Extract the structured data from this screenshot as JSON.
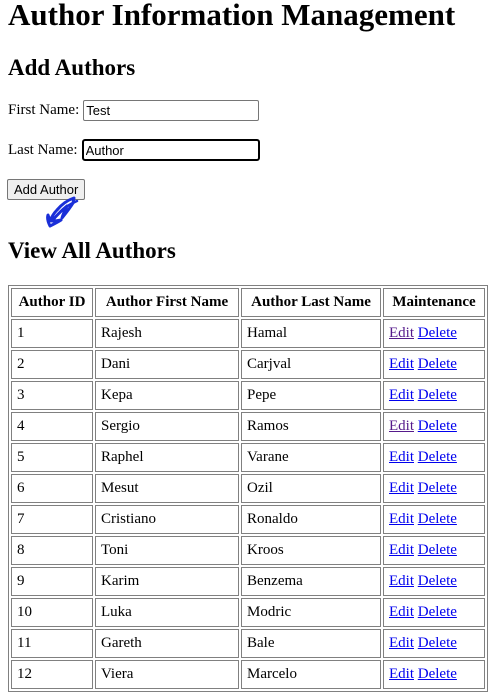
{
  "page": {
    "title": "Author Information Management",
    "add_heading": "Add Authors",
    "view_heading": "View All Authors"
  },
  "form": {
    "first_name_label": "First Name:",
    "first_name_value": "Test",
    "last_name_label": "Last Name:",
    "last_name_value": "Author",
    "submit_label": "Add Author"
  },
  "table": {
    "headers": [
      "Author ID",
      "Author First Name",
      "Author Last Name",
      "Maintenance"
    ],
    "edit_label": "Edit",
    "delete_label": "Delete",
    "rows": [
      {
        "id": "1",
        "first": "Rajesh",
        "last": "Hamal",
        "edit_visited": true
      },
      {
        "id": "2",
        "first": "Dani",
        "last": "Carjval",
        "edit_visited": false
      },
      {
        "id": "3",
        "first": "Kepa",
        "last": "Pepe",
        "edit_visited": false
      },
      {
        "id": "4",
        "first": "Sergio",
        "last": "Ramos",
        "edit_visited": true
      },
      {
        "id": "5",
        "first": "Raphel",
        "last": "Varane",
        "edit_visited": false
      },
      {
        "id": "6",
        "first": "Mesut",
        "last": "Ozil",
        "edit_visited": false
      },
      {
        "id": "7",
        "first": "Cristiano",
        "last": "Ronaldo",
        "edit_visited": false
      },
      {
        "id": "8",
        "first": "Toni",
        "last": "Kroos",
        "edit_visited": false
      },
      {
        "id": "9",
        "first": "Karim",
        "last": "Benzema",
        "edit_visited": false
      },
      {
        "id": "10",
        "first": "Luka",
        "last": "Modric",
        "edit_visited": false
      },
      {
        "id": "11",
        "first": "Gareth",
        "last": "Bale",
        "edit_visited": false
      },
      {
        "id": "12",
        "first": "Viera",
        "last": "Marcelo",
        "edit_visited": false
      }
    ]
  },
  "colors": {
    "link": "#0000ee",
    "visited_link": "#551a8b",
    "cursor": "#1a2fd8"
  },
  "icons": {
    "cursor": "hand-pointer-icon"
  }
}
